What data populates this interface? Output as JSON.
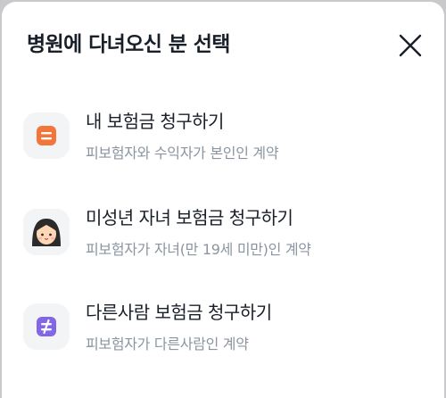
{
  "sheet": {
    "title": "병원에 다녀오신 분 선택",
    "close_icon": "close-icon"
  },
  "options": [
    {
      "title": "내 보험금 청구하기",
      "subtitle": "피보험자와 수익자가 본인인 계약",
      "icon": "equals-icon",
      "icon_color": "#f2763c"
    },
    {
      "title": "미성년 자녀 보험금 청구하기",
      "subtitle": "피보험자가 자녀(만 19세 미만)인 계약",
      "icon": "child-face-icon",
      "icon_color": "#2b2b2b"
    },
    {
      "title": "다른사람 보험금 청구하기",
      "subtitle": "피보험자가 다른사람인 계약",
      "icon": "not-equal-icon",
      "icon_color": "#8266e6"
    }
  ]
}
